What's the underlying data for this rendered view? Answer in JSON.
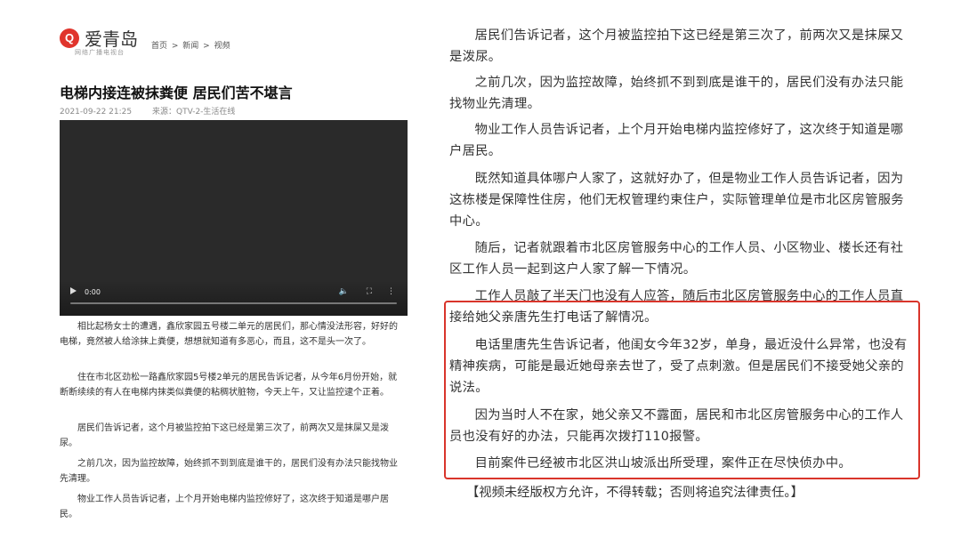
{
  "site": {
    "logo_mark": "Q",
    "logo_text": "爱青岛",
    "logo_sub": "网络广播电视台"
  },
  "breadcrumb": [
    "首页",
    "新闻",
    "视频"
  ],
  "article": {
    "title": "电梯内接连被抹粪便 居民们苦不堪言",
    "datetime": "2021-09-22 21:25",
    "source": "来源：QTV-2-生活在线",
    "paragraphs": [
      "相比起杨女士的遭遇，鑫欣家园五号楼二单元的居民们，那心情没法形容，好好的电梯，竟然被人给涂抹上粪便，想想就知道有多恶心，而且，这不是头一次了。",
      "住在市北区劲松一路鑫欣家园5号楼2单元的居民告诉记者，从今年6月份开始，就断断续续的有人在电梯内抹类似粪便的粘稠状脏物，今天上午，又让监控逮个正着。",
      "居民们告诉记者，这个月被监控拍下这已经是第三次了，前两次又是抹屎又是泼尿。",
      "之前几次，因为监控故障，始终抓不到到底是谁干的，居民们没有办法只能找物业先清理。",
      "物业工作人员告诉记者，上个月开始电梯内监控修好了，这次终于知道是哪户居民。"
    ]
  },
  "video": {
    "time": "0:00"
  },
  "right_column": {
    "paragraphs": [
      "居民们告诉记者，这个月被监控拍下这已经是第三次了，前两次又是抹屎又是泼尿。",
      "之前几次，因为监控故障，始终抓不到到底是谁干的，居民们没有办法只能找物业先清理。",
      "物业工作人员告诉记者，上个月开始电梯内监控修好了，这次终于知道是哪户居民。",
      "既然知道具体哪户人家了，这就好办了，但是物业工作人员告诉记者，因为这栋楼是保障性住房，他们无权管理约束住户，实际管理单位是市北区房管服务中心。",
      "随后，记者就跟着市北区房管服务中心的工作人员、小区物业、楼长还有社区工作人员一起到这户人家了解一下情况。",
      "工作人员敲了半天门也没有人应答，随后市北区房管服务中心的工作人员直接给她父亲唐先生打电话了解情况。",
      "电话里唐先生告诉记者，他闺女今年32岁，单身，最近没什么异常，也没有精神疾病，可能是最近她母亲去世了，受了点刺激。但是居民们不接受她父亲的说法。",
      "因为当时人不在家，她父亲又不露面，居民和市北区房管服务中心的工作人员也没有好的办法，只能再次拨打110报警。",
      "目前案件已经被市北区洪山坡派出所受理，案件正在尽快侦办中。"
    ],
    "note": "【视频未经版权方允许，不得转载；否则将追究法律责任。】"
  },
  "colors": {
    "highlight": "#d9352b",
    "logo": "#e0342c"
  }
}
